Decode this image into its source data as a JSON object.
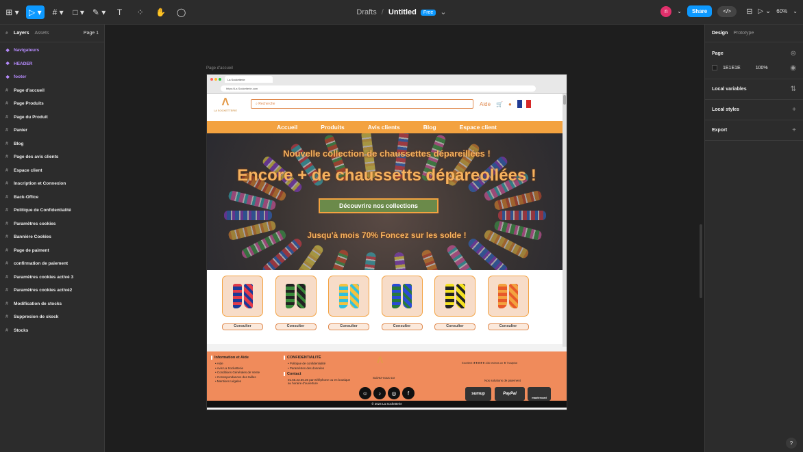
{
  "toolbar": {
    "tools": [
      "⊞ ▾",
      "▷ ▾",
      "# ▾",
      "□ ▾",
      "✎ ▾",
      "T",
      "⁘",
      "✋",
      "◯"
    ],
    "breadcrumb_parent": "Drafts",
    "separator": "/",
    "file_name": "Untitled",
    "plan_badge": "Free",
    "avatar_letter": "n",
    "share_label": "Share",
    "zoom": "60%"
  },
  "left_panel": {
    "tab_layers": "Layers",
    "tab_assets": "Assets",
    "page_selector": "Page 1",
    "layers": [
      {
        "label": "Navigateurs",
        "type": "component"
      },
      {
        "label": "HEADER",
        "type": "component"
      },
      {
        "label": "footer",
        "type": "component"
      },
      {
        "label": "Page d'accueil",
        "type": "frame"
      },
      {
        "label": "Page Produits",
        "type": "frame"
      },
      {
        "label": "Page du Produit",
        "type": "frame"
      },
      {
        "label": "Panier",
        "type": "frame"
      },
      {
        "label": "Blog",
        "type": "frame"
      },
      {
        "label": "Page des avis clients",
        "type": "frame"
      },
      {
        "label": "Espace client",
        "type": "frame"
      },
      {
        "label": "Inscription et Connexion",
        "type": "frame"
      },
      {
        "label": "Back-Office",
        "type": "frame"
      },
      {
        "label": "Politique de Confidentialité",
        "type": "frame"
      },
      {
        "label": "Paramètres cookies",
        "type": "frame"
      },
      {
        "label": "Bannière Cookies",
        "type": "frame"
      },
      {
        "label": "Page de paiment",
        "type": "frame"
      },
      {
        "label": "confirmation de paiement",
        "type": "frame"
      },
      {
        "label": "Paramètres cookies activé 3",
        "type": "frame"
      },
      {
        "label": "Paramètres cookies activé2",
        "type": "frame"
      },
      {
        "label": "Modification de stocks",
        "type": "frame"
      },
      {
        "label": "Suppresion de skock",
        "type": "frame"
      },
      {
        "label": "Stocks",
        "type": "frame"
      }
    ]
  },
  "right_panel": {
    "tab_design": "Design",
    "tab_prototype": "Prototype",
    "page_section": "Page",
    "page_color": "1E1E1E",
    "page_opacity": "100%",
    "local_variables": "Local variables",
    "local_styles": "Local styles",
    "export": "Export",
    "help": "?"
  },
  "canvas": {
    "frame_label": "Page d'accueil",
    "browser_tab": "La Socketterie",
    "url": "https://La Socketterie.com",
    "site": {
      "logo_text": "LA SOCKETTERIE",
      "search_placeholder": "Recherche",
      "help_link": "Aide",
      "nav": [
        "Accueil",
        "Produits",
        "Avis clients",
        "Blog",
        "Espace client"
      ],
      "hero_line1": "Nouvelle collection de chaussettes dépareillées !",
      "hero_line2": "Encore + de chaussetts dépareollées !",
      "hero_cta": "Découvrire nos collections",
      "hero_line3": "Jusqu'à mois 70% Foncez sur les solde !",
      "consult_label": "Consulter",
      "footer": {
        "col1_title": "Information et Aide",
        "col1_items": [
          "Aide",
          "Avis La Socketterie",
          "Conditions Générales de Vente",
          "Correspondances des tailles",
          "Mentions Légales"
        ],
        "col2_title": "CONFIDENTIALITÉ",
        "col2_items": [
          "Politique de confidentialité",
          "Paramètres des données"
        ],
        "contact_title": "Contact",
        "contact_text": "01.65.23.56.36 part téléphone ou en boutique au horaire d'ouverture",
        "follow": "Suivez-nous sur",
        "trust": "Excellent ★★★★★ 436 reviews on ★ Trustpilot",
        "payment_title": "Nos solutions de paiement",
        "pay1": "sumup",
        "pay2": "PayPal",
        "pay3": "mastercard",
        "copyright": "© 2024 La Socketterie"
      }
    }
  },
  "colors": {
    "accent": "#0d99ff",
    "site_orange": "#f3a240",
    "footer": "#f08b5b"
  }
}
